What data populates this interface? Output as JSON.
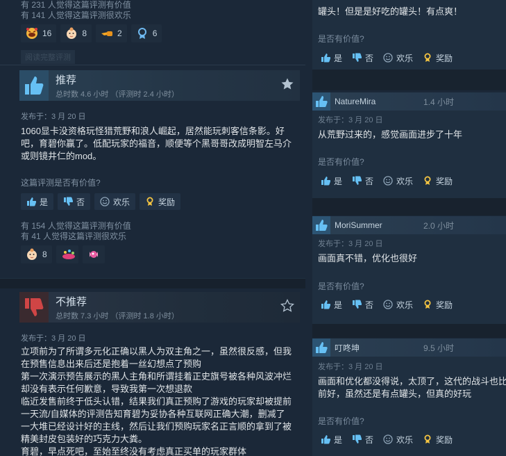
{
  "top_review": {
    "helpful_line": "有 231 人觉得这篇评测有价值",
    "funny_line": "有 141 人觉得这篇评测很欢乐",
    "awards": [
      {
        "icon": "laughing-face-award-icon",
        "count": "16"
      },
      {
        "icon": "baby-award-icon",
        "count": "8"
      },
      {
        "icon": "pointing-hand-award-icon",
        "count": "2"
      },
      {
        "icon": "medal-award-icon",
        "count": "6"
      }
    ],
    "read_more": "阅读完整评测"
  },
  "review1": {
    "verdict": "推荐",
    "hours": "总时数 4.6 小时 （评测时 2.4 小时）",
    "posted": "发布于：3 月 20 日",
    "text": [
      "1060显卡没资格玩怪猎荒野和浪人崛起，居然能玩刺客信条影。好",
      "吧，育碧你赢了。低配玩家的福音，顺便等个黑哥哥改成明智左马介",
      "或则镜井仁的mod。"
    ],
    "question": "这篇评测是否有价值?",
    "buttons": {
      "yes": "是",
      "no": "否",
      "funny": "欢乐",
      "award": "奖励"
    },
    "helpful_line": "有 154 人觉得这篇评测有价值",
    "funny_line": "有 41 人觉得这篇评测很欢乐",
    "awards": [
      {
        "icon": "baby-award-icon",
        "count": "8"
      },
      {
        "icon": "confetti-award-icon",
        "count": ""
      },
      {
        "icon": "candy-award-icon",
        "count": ""
      }
    ]
  },
  "review2": {
    "verdict": "不推荐",
    "hours": "总时数 7.3 小时 （评测时 1.8 小时）",
    "posted": "发布于：3 月 20 日",
    "text": [
      "立项前为了所谓多元化正确以黑人为双主角之一，虽然很反感，但我",
      "在预售信息出来后还是抱着一丝幻想点了预购",
      "第一次演示预告展示的黑人主角和所谓挂着正史旗号被各种风波冲烂",
      "却没有表示任何歉意，导致我第一次想退款",
      "临近发售前终于低头认错，结果我们真正预购了游戏的玩家却被提前",
      "一天流/自媒体的评测告知育碧为妥协各种互联网正确大潮，删减了",
      "一大堆已经设计好的主线，然后让我们预购玩家名正言顺的拿到了被",
      "精美封皮包装好的巧克力大粪。",
      "育碧，早点死吧，至始至终没有考虑真正买单的玩家群体"
    ]
  },
  "right": {
    "partial_text": "罐头！但是是好吃的罐头！有点爽！",
    "question": "是否有价值?",
    "buttons": {
      "yes": "是",
      "no": "否",
      "funny": "欢乐",
      "award": "奖励"
    },
    "reviews": [
      {
        "name": "NatureMira",
        "hours": "1.4 小时",
        "posted": "发布于：3 月 20 日",
        "text": [
          "从荒野过来的，感觉画面进步了十年"
        ]
      },
      {
        "name": "MoriSummer",
        "hours": "2.0 小时",
        "posted": "发布于：3 月 20 日",
        "text": [
          "画面真不错，优化也很好"
        ]
      },
      {
        "name": "叮咚坤",
        "hours": "9.5 小时",
        "posted": "发布于：3 月 20 日",
        "text": [
          "画面和优化都没得说，太顶了，这代的战斗也比",
          "前好，虽然还是有点罐头，但真的好玩"
        ]
      }
    ]
  }
}
